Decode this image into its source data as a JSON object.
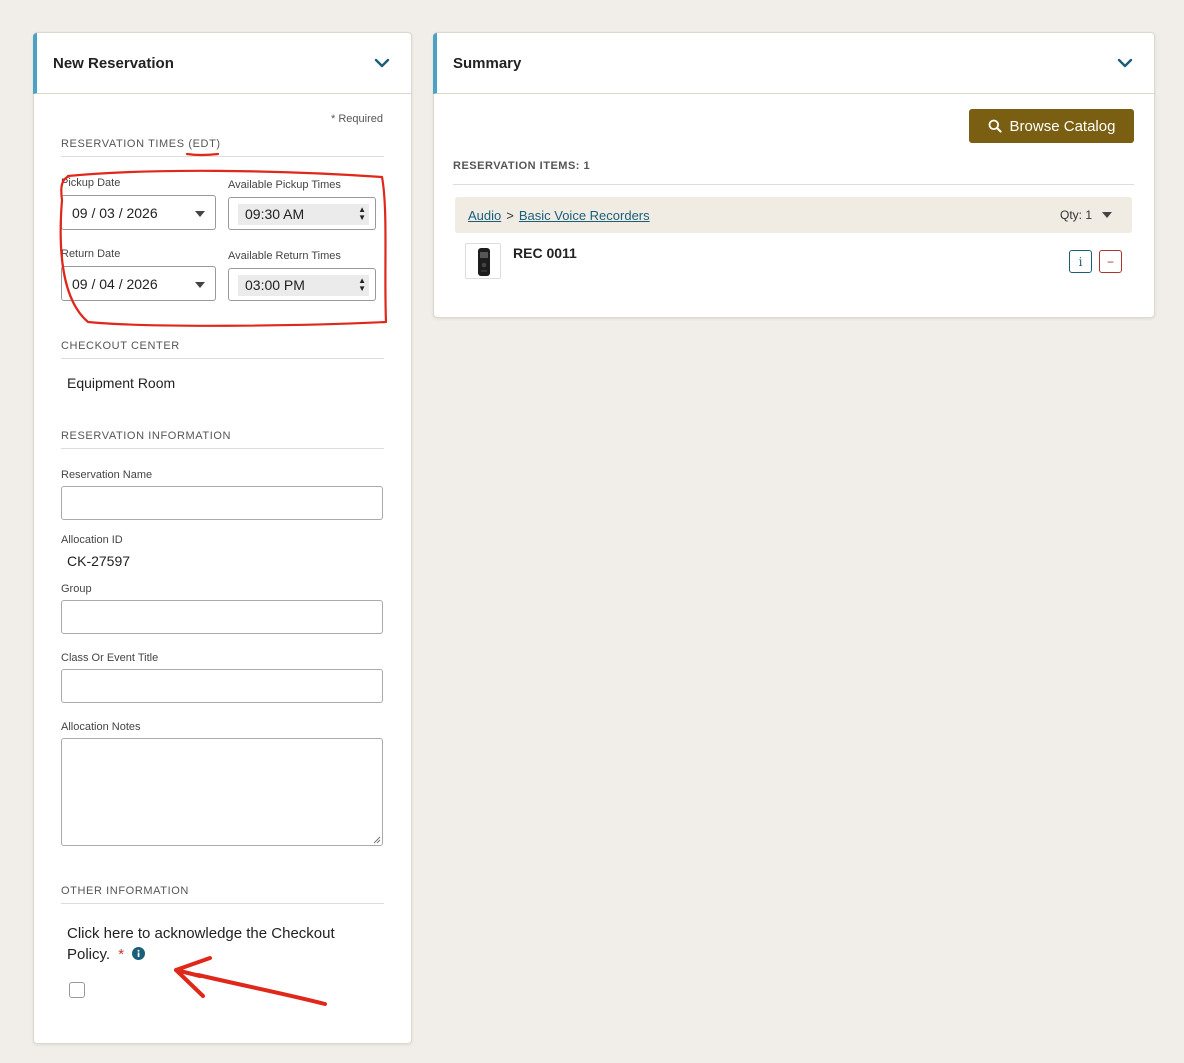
{
  "reservation_panel": {
    "title": "New Reservation",
    "required_note": "* Required",
    "times_section": {
      "title_prefix": "RESERVATION TIMES (",
      "timezone": "EDT",
      "title_suffix": ")"
    },
    "pickup_date": {
      "label": "Pickup Date",
      "value": "09 / 03 / 2026"
    },
    "pickup_time": {
      "label": "Available Pickup Times",
      "value": "09:30 AM"
    },
    "return_date": {
      "label": "Return Date",
      "value": "09 / 04 / 2026"
    },
    "return_time": {
      "label": "Available Return Times",
      "value": "03:00 PM"
    },
    "checkout_center": {
      "title": "CHECKOUT CENTER",
      "value": "Equipment Room"
    },
    "info_section": {
      "title": "RESERVATION INFORMATION",
      "reservation_name_label": "Reservation Name",
      "allocation_id_label": "Allocation ID",
      "allocation_id_value": "CK-27597",
      "group_label": "Group",
      "class_title_label": "Class Or Event Title",
      "allocation_notes_label": "Allocation Notes"
    },
    "other_section": {
      "title": "OTHER INFORMATION",
      "policy_text_line1": "Click here to acknowledge the Checkout",
      "policy_text_line2": "Policy.",
      "required_star": "*"
    }
  },
  "summary_panel": {
    "title": "Summary",
    "browse_button": "Browse Catalog",
    "items_title": "RESERVATION ITEMS: 1",
    "category": "Audio",
    "separator": ">",
    "subcategory": "Basic Voice Recorders",
    "qty": "Qty: 1",
    "item_name": "REC 0011",
    "info_button": "i",
    "remove_button": "−"
  },
  "colors": {
    "accent_bar": "#4aa3c3",
    "browse_button": "#7a5f12",
    "link": "#1a5f7a",
    "remove": "#aa3333",
    "annotation_red": "#e0281a"
  }
}
